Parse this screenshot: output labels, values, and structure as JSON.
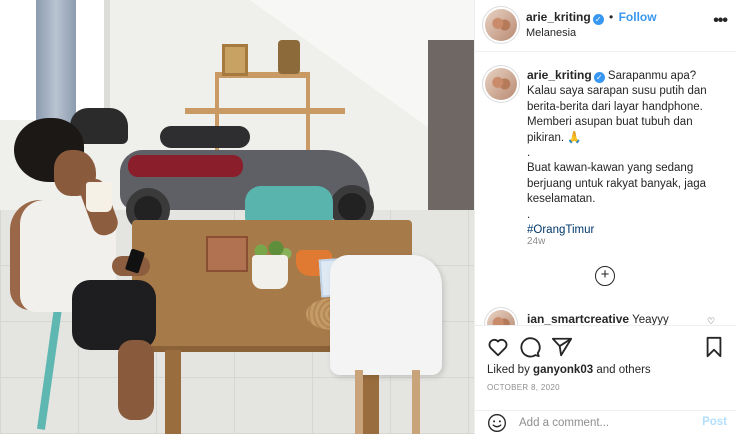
{
  "post": {
    "image_alt": "",
    "header": {
      "username": "arie_kriting",
      "separator": "•",
      "follow_label": "Follow",
      "location": "Melanesia",
      "more_icon": "more-dots-icon"
    },
    "caption": {
      "username": "arie_kriting",
      "lines": [
        "Sarapanmu apa?",
        "Kalau saya sarapan susu putih dan",
        "berita-berita dari layar handphone.",
        "Memberi asupan buat tubuh dan",
        "pikiran. 🙏",
        ".",
        "Buat kawan-kawan yang sedang",
        "berjuang untuk rakyat banyak, jaga",
        "keselamatan.",
        "."
      ],
      "hashtag": "#OrangTimur",
      "age": "24w"
    },
    "load_more_icon": "plus-circle-icon",
    "comment_preview": {
      "username": "ian_smartcreative",
      "text": "Yeayyy"
    },
    "actions": {
      "like_icon": "heart-icon",
      "comment_icon": "comment-icon",
      "share_icon": "paper-plane-icon",
      "save_icon": "bookmark-icon"
    },
    "likes": {
      "prefix": "Liked by",
      "user": "ganyonk03",
      "suffix": "and others"
    },
    "date": "OCTOBER 8, 2020",
    "add_comment": {
      "placeholder": "Add a comment...",
      "post_label": "Post",
      "emoji_icon": "smiley-icon"
    }
  },
  "colors": {
    "accent": "#3897f0",
    "hashtag": "#00376b",
    "muted": "#8e8e8e",
    "post_disabled": "#b2dffc"
  }
}
